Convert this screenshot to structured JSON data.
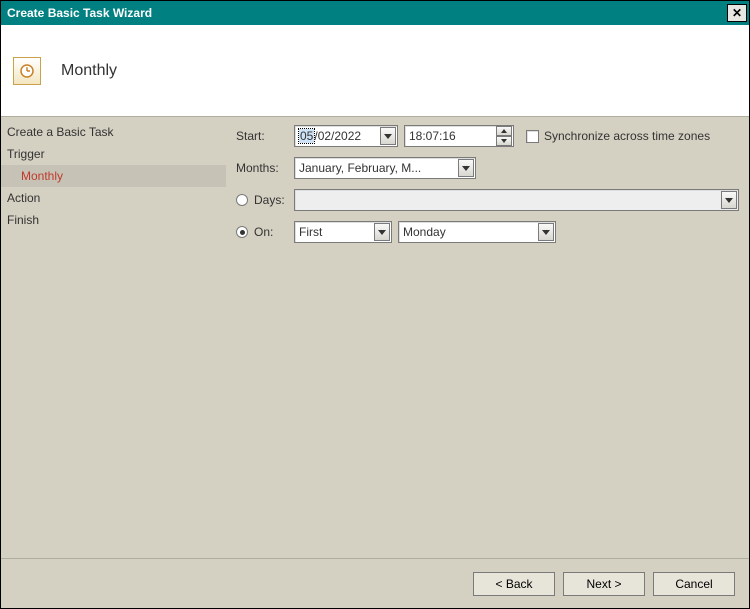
{
  "window": {
    "title": "Create Basic Task Wizard"
  },
  "header": {
    "title": "Monthly"
  },
  "sidebar": {
    "items": [
      {
        "label": "Create a Basic Task"
      },
      {
        "label": "Trigger"
      },
      {
        "label": "Monthly"
      },
      {
        "label": "Action"
      },
      {
        "label": "Finish"
      }
    ]
  },
  "form": {
    "start_label": "Start:",
    "date_prefix_selected": "05",
    "date_suffix": "/02/2022",
    "time_value": "18:07:16",
    "sync_label": "Synchronize across time zones",
    "months_label": "Months:",
    "months_value": "January, February, M...",
    "days_label": "Days:",
    "days_value": "",
    "on_label": "On:",
    "on_ordinal": "First",
    "on_day": "Monday"
  },
  "footer": {
    "back": "< Back",
    "next": "Next >",
    "cancel": "Cancel"
  }
}
